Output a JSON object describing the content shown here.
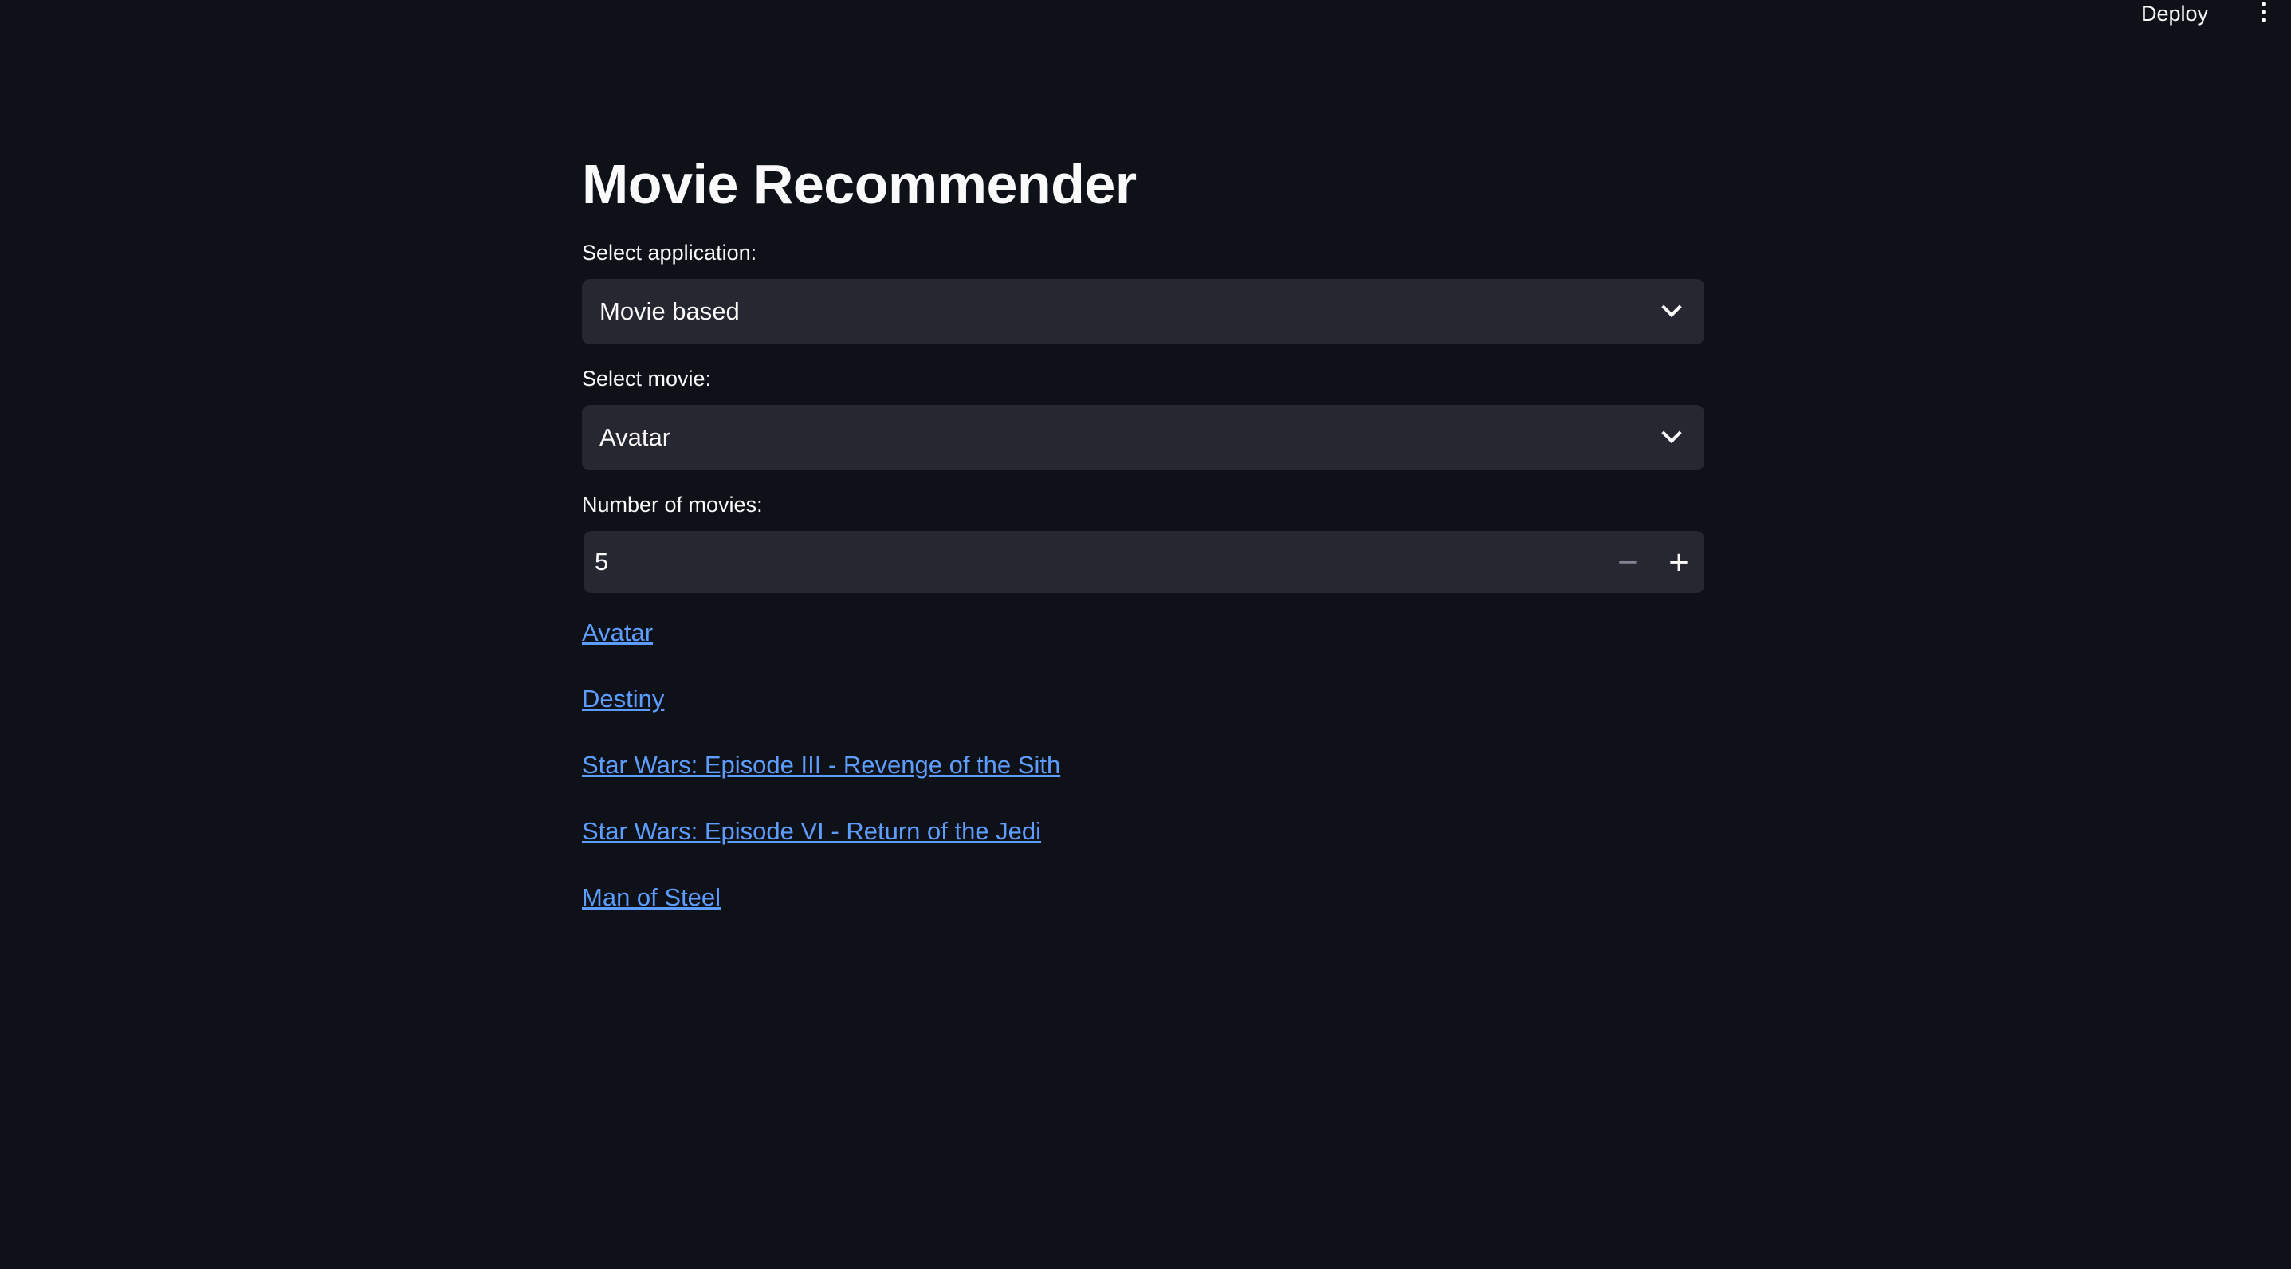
{
  "header": {
    "deploy_label": "Deploy",
    "menu_icon": "kebab-menu-icon"
  },
  "main": {
    "title": "Movie Recommender",
    "application_select": {
      "label": "Select application:",
      "value": "Movie based",
      "icon": "chevron-down-icon"
    },
    "movie_select": {
      "label": "Select movie:",
      "value": "Avatar",
      "icon": "chevron-down-icon"
    },
    "number_input": {
      "label": "Number of movies:",
      "value": "5",
      "minus": "−",
      "plus": "+"
    },
    "results": [
      "Avatar",
      "Destiny",
      "Star Wars: Episode III - Revenge of the Sith",
      "Star Wars: Episode VI - Return of the Jedi",
      "Man of Steel"
    ]
  },
  "colors": {
    "background": "#0e1117",
    "input_background": "#262730",
    "link": "#5c9dff",
    "text": "#fafafa"
  }
}
